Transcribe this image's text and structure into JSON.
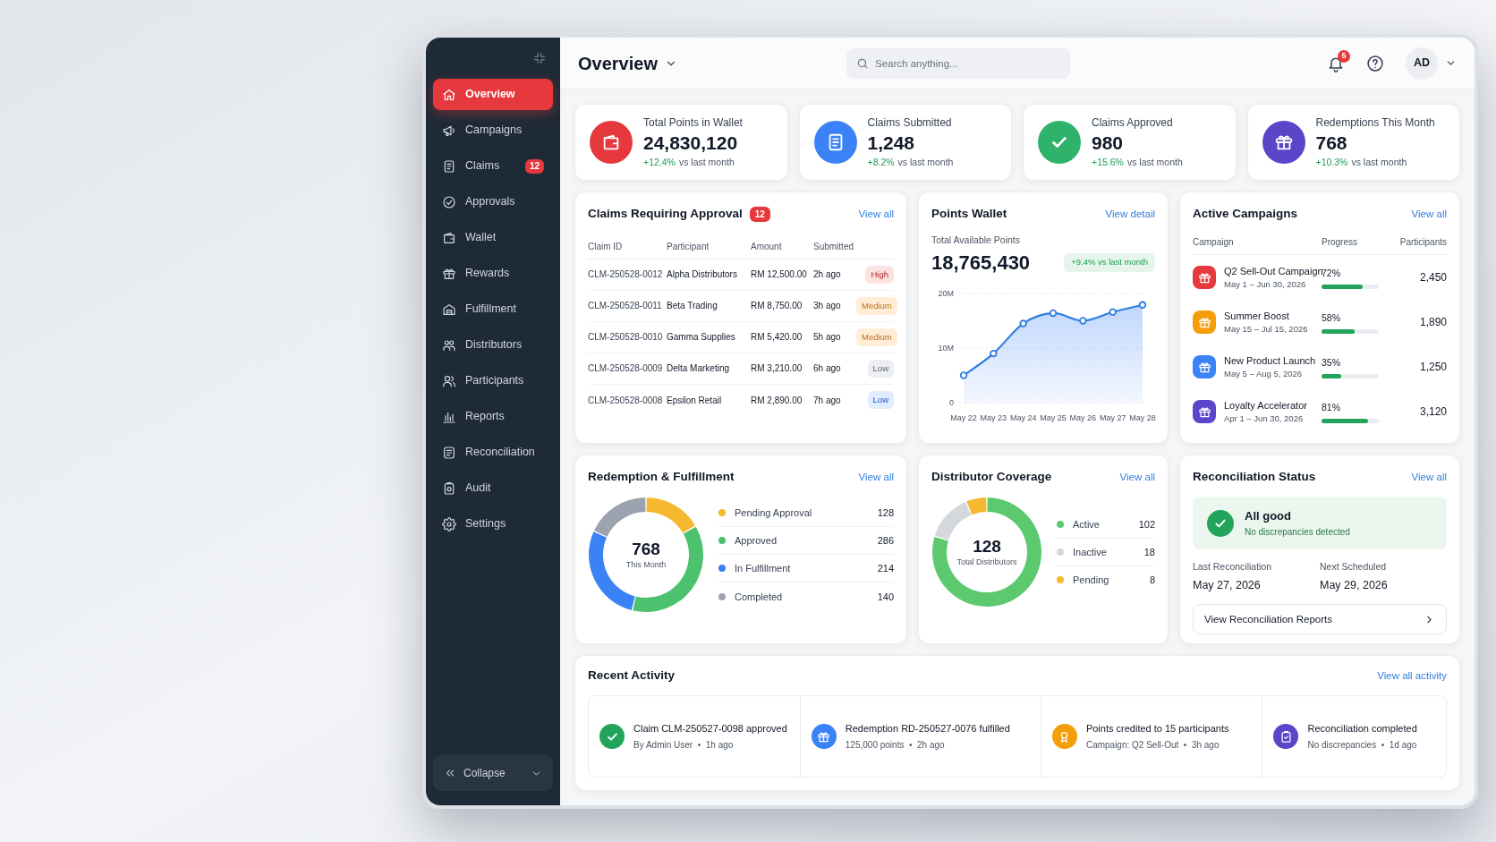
{
  "sidebar": {
    "items": [
      {
        "label": "Overview",
        "selected": true
      },
      {
        "label": "Campaigns",
        "selected": false
      },
      {
        "label": "Claims",
        "selected": false,
        "badge": "12"
      },
      {
        "label": "Approvals",
        "selected": false
      },
      {
        "label": "Wallet",
        "selected": false
      },
      {
        "label": "Rewards",
        "selected": false
      },
      {
        "label": "Fulfillment",
        "selected": false
      },
      {
        "label": "Distributors",
        "selected": false
      },
      {
        "label": "Participants",
        "selected": false
      },
      {
        "label": "Reports",
        "selected": false
      },
      {
        "label": "Reconciliation",
        "selected": false
      },
      {
        "label": "Audit",
        "selected": false
      },
      {
        "label": "Settings",
        "selected": false
      }
    ],
    "collapse_button": "Collapse"
  },
  "header": {
    "title": "Overview",
    "search": {
      "placeholder": "Search anything..."
    },
    "notification_count": "5",
    "avatar": "AD"
  },
  "kpi_cards": [
    {
      "label": "Total Points in Wallet",
      "value": "24,830,120",
      "change": "+12.4%",
      "change_note": "vs last month",
      "color": "#e5393d"
    },
    {
      "label": "Claims Submitted",
      "value": "1,248",
      "change": "+8.2%",
      "change_note": "vs last month",
      "color": "#3b82f6"
    },
    {
      "label": "Claims Approved",
      "value": "980",
      "change": "+15.6%",
      "change_note": "vs last month",
      "color": "#2fb36b"
    },
    {
      "label": "Redemptions This Month",
      "value": "768",
      "change": "+10.3%",
      "change_note": "vs last month",
      "color": "#5b45c9"
    }
  ],
  "claims": {
    "title": "Claims Requiring Approval",
    "count": "12",
    "link": "View all",
    "columns": [
      "Claim ID",
      "Participant",
      "Amount",
      "Submitted"
    ],
    "rows": [
      {
        "claim_id": "CLM-250528-0012",
        "participant": "Alpha Distributors",
        "amount": "RM 12,500.00",
        "submitted": "2h ago",
        "priority": "High",
        "color": "#fde2e2"
      },
      {
        "claim_id": "CLM-250528-0011",
        "participant": "Beta Trading",
        "amount": "RM 8,750.00",
        "submitted": "3h ago",
        "priority": "Medium",
        "color": "#ffedd8"
      },
      {
        "claim_id": "CLM-250528-0010",
        "participant": "Gamma Supplies",
        "amount": "RM 5,420.00",
        "submitted": "5h ago",
        "priority": "Medium",
        "color": "#ffedd8"
      },
      {
        "claim_id": "CLM-250528-0009",
        "participant": "Delta Marketing",
        "amount": "RM 3,210.00",
        "submitted": "6h ago",
        "priority": "Low",
        "color": "#eceef2"
      },
      {
        "claim_id": "CLM-250528-0008",
        "participant": "Epsilon Retail",
        "amount": "RM 2,890.00",
        "submitted": "7h ago",
        "priority": "Low",
        "color": "#e0ecff"
      }
    ]
  },
  "points_wallet": {
    "title": "Points Wallet",
    "link": "View detail",
    "label": "Total Available Points",
    "value": "18,765,430",
    "change": "+9.4% vs last month",
    "chart_data": {
      "type": "area",
      "categories": [
        "May 22",
        "May 23",
        "May 24",
        "May 25",
        "May 26",
        "May 27",
        "May 28"
      ],
      "values": [
        5.0,
        9.0,
        14.5,
        16.4,
        15.0,
        16.6,
        17.9
      ],
      "ylim": [
        0,
        20
      ],
      "yticks": [
        {
          "value": 0,
          "label": "0"
        },
        {
          "value": 10,
          "label": "10M"
        },
        {
          "value": 20,
          "label": "20M"
        }
      ]
    }
  },
  "active_campaigns": {
    "title": "Active Campaigns",
    "link": "View all",
    "columns": [
      "Campaign",
      "Progress",
      "Participants"
    ],
    "rows": [
      {
        "name": "Q2 Sell-Out Campaign",
        "dates": "May 1 – Jun 30, 2026",
        "progress": "72%",
        "level": 0.72,
        "participants": "2,450",
        "color": "#e5393d"
      },
      {
        "name": "Summer Boost",
        "dates": "May 15 – Jul 15, 2026",
        "progress": "58%",
        "level": 0.58,
        "participants": "1,890",
        "color": "#f59e0b"
      },
      {
        "name": "New Product Launch",
        "dates": "May 5 – Aug 5, 2026",
        "progress": "35%",
        "level": 0.35,
        "participants": "1,250",
        "color": "#3b82f6"
      },
      {
        "name": "Loyalty Accelerator",
        "dates": "Apr 1 – Jun 30, 2026",
        "progress": "81%",
        "level": 0.81,
        "participants": "3,120",
        "color": "#5b45c9"
      }
    ]
  },
  "redemption_fulfillment": {
    "title": "Redemption & Fulfillment",
    "link": "View all",
    "total": "768",
    "total_label": "This Month",
    "chart_data": {
      "type": "donut",
      "categories": [
        "Pending Approval",
        "Approved",
        "In Fulfillment",
        "Completed"
      ],
      "values": [
        128,
        286,
        214,
        140
      ],
      "value_labels": [
        "128",
        "286",
        "214",
        "140"
      ],
      "colors": [
        "#f5b82e",
        "#4cc26f",
        "#3b82f6",
        "#9ca3af"
      ],
      "legend": true
    }
  },
  "distributor_coverage": {
    "title": "Distributor Coverage",
    "link": "View all",
    "total": "128",
    "total_label": "Total Distributors",
    "chart_data": {
      "type": "donut",
      "categories": [
        "Active",
        "Inactive",
        "Pending"
      ],
      "values": [
        102,
        18,
        8
      ],
      "value_labels": [
        "102",
        "18",
        "8"
      ],
      "colors": [
        "#5cc96e",
        "#d4d7dc",
        "#f5b82e"
      ],
      "legend": true
    }
  },
  "reconciliation_status": {
    "title": "Reconciliation Status",
    "link": "View all",
    "status_title": "All good",
    "status_note": "No discrepancies detected",
    "fields": [
      {
        "label": "Last Reconciliation",
        "value": "May 27, 2026"
      },
      {
        "label": "Next Scheduled",
        "value": "May 29, 2026"
      }
    ],
    "button": "View Reconciliation Reports"
  },
  "recent_activity": {
    "title": "Recent Activity",
    "link": "View all activity",
    "items": [
      {
        "title": "Claim CLM-250527-0098 approved",
        "meta": "By Admin User  •  1h ago",
        "color": "#22a55b"
      },
      {
        "title": "Redemption RD-250527-0076 fulfilled",
        "meta": "125,000 points  •  2h ago",
        "color": "#3b82f6"
      },
      {
        "title": "Points credited to 15 participants",
        "meta": "Campaign: Q2 Sell-Out  •  3h ago",
        "color": "#f59e0b"
      },
      {
        "title": "Reconciliation completed",
        "meta": "No discrepancies  •  1d ago",
        "color": "#5b45c9"
      }
    ]
  }
}
